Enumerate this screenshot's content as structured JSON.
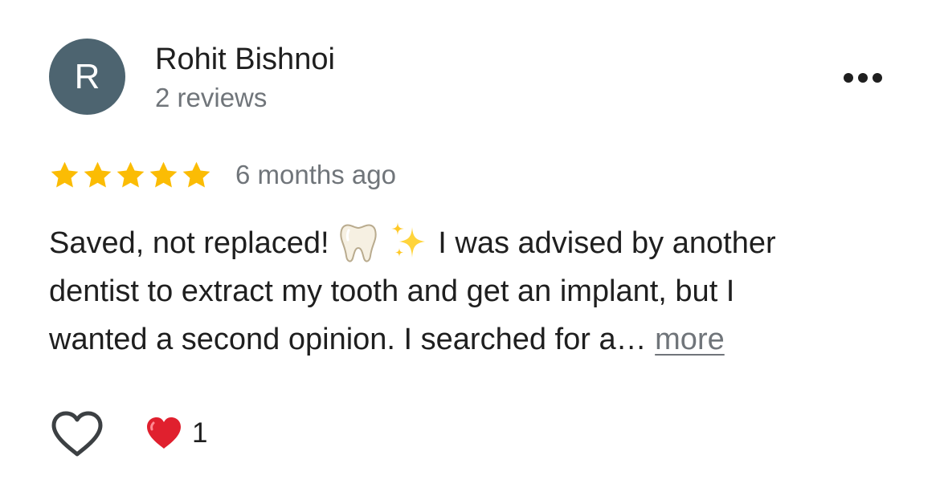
{
  "reviewer": {
    "initial": "R",
    "name": "Rohit Bishnoi",
    "review_count": "2 reviews",
    "avatar_color": "#4d6470"
  },
  "menu": {
    "icon": "more-horizontal-icon"
  },
  "rating": {
    "stars": 5,
    "max_stars": 5,
    "star_color": "#fbbc04",
    "time_ago": "6 months ago"
  },
  "review": {
    "line1_before_emoji": "Saved, not replaced!",
    "emoji_1": "tooth-emoji",
    "emoji_2": "sparkles-emoji",
    "line1_after_emoji": "I was advised by another",
    "line2": "dentist to extract my tooth and get an implant, but I",
    "line3": "wanted a second opinion. I searched for a…",
    "more_label": "more"
  },
  "actions": {
    "like_icon": "heart-outline-icon",
    "reaction_icon": "red-heart-icon",
    "reaction_count": "1"
  }
}
